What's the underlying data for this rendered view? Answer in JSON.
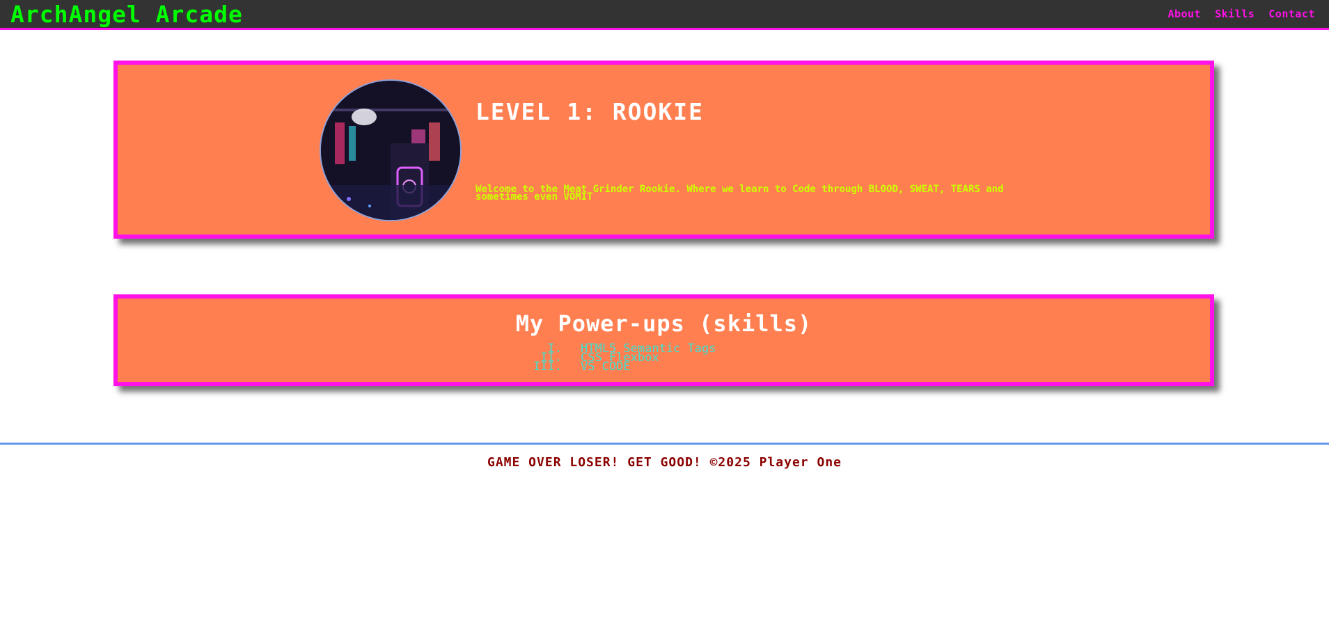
{
  "header": {
    "brand": "ArchAngel Arcade",
    "nav": [
      "About",
      "Skills",
      "Contact"
    ]
  },
  "hero": {
    "image_icon": "arcade-photo",
    "title": "LEVEL 1: ROOKIE",
    "text": "Welcome to the Meat Grinder Rookie. Where we learn to Code through BLOOD, SWEAT, TEARS and sometimes even VOMIT"
  },
  "skills": {
    "title": "My Power-ups (skills)",
    "items": [
      {
        "num": "I.",
        "label": "HTML5 Semantic Tags"
      },
      {
        "num": "II.",
        "label": "CSS Flexbox"
      },
      {
        "num": "III.",
        "label": "VS CODE"
      }
    ]
  },
  "footer": {
    "text": "GAME OVER LOSER! GET GOOD! ©2025 Player One"
  },
  "colors": {
    "topbar": "#333333",
    "brand": "#00ff00",
    "accent": "#ff11e8",
    "panel": "#ff7f50",
    "hero_text": "#ccff00",
    "skill_text": "#40e0d0",
    "footer_text": "#8b0000",
    "footer_line": "#6495ed"
  }
}
